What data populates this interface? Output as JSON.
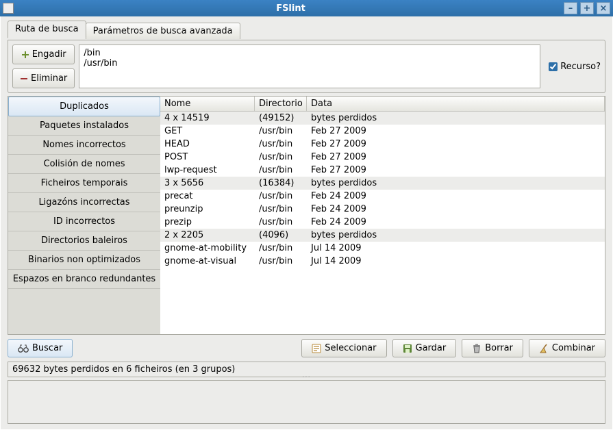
{
  "window": {
    "title": "FSlint"
  },
  "titlebar_buttons": {
    "min": "–",
    "max": "+",
    "close": "×"
  },
  "tabs": {
    "search_path": "Ruta de busca",
    "advanced": "Parámetros de busca avanzada"
  },
  "search_path": {
    "add": "Engadir",
    "remove": "Eliminar",
    "paths": "/bin\n/usr/bin",
    "recurse_label": "Recurso?",
    "recurse_checked": true
  },
  "sidebar": {
    "items": [
      "Duplicados",
      "Paquetes instalados",
      "Nomes incorrectos",
      "Colisión de nomes",
      "Ficheiros temporais",
      "Ligazóns incorrectas",
      "ID incorrectos",
      "Directorios baleiros",
      "Binarios non optimizados",
      "Espazos en branco redundantes"
    ],
    "active_index": 0
  },
  "columns": {
    "name": "Nome",
    "dir": "Directorio",
    "date": "Data"
  },
  "rows": [
    {
      "group": true,
      "name": "4 x 14519",
      "dir": "(49152)",
      "date": "bytes perdidos"
    },
    {
      "group": false,
      "name": "GET",
      "dir": "/usr/bin",
      "date": "Feb 27 2009"
    },
    {
      "group": false,
      "name": "HEAD",
      "dir": "/usr/bin",
      "date": "Feb 27 2009"
    },
    {
      "group": false,
      "name": "POST",
      "dir": "/usr/bin",
      "date": "Feb 27 2009"
    },
    {
      "group": false,
      "name": "lwp-request",
      "dir": "/usr/bin",
      "date": "Feb 27 2009"
    },
    {
      "group": true,
      "name": "3 x 5656",
      "dir": "(16384)",
      "date": "bytes perdidos"
    },
    {
      "group": false,
      "name": "precat",
      "dir": "/usr/bin",
      "date": "Feb 24 2009"
    },
    {
      "group": false,
      "name": "preunzip",
      "dir": "/usr/bin",
      "date": "Feb 24 2009"
    },
    {
      "group": false,
      "name": "prezip",
      "dir": "/usr/bin",
      "date": "Feb 24 2009"
    },
    {
      "group": true,
      "name": "2 x 2205",
      "dir": "(4096)",
      "date": "bytes perdidos"
    },
    {
      "group": false,
      "name": "gnome-at-mobility",
      "dir": "/usr/bin",
      "date": "Jul 14 2009"
    },
    {
      "group": false,
      "name": "gnome-at-visual",
      "dir": "/usr/bin",
      "date": "Jul 14 2009"
    }
  ],
  "buttons": {
    "find": "Buscar",
    "select": "Seleccionar",
    "save": "Gardar",
    "delete": "Borrar",
    "merge": "Combinar"
  },
  "status": "69632 bytes perdidos en 6 ficheiros (en 3 grupos)"
}
